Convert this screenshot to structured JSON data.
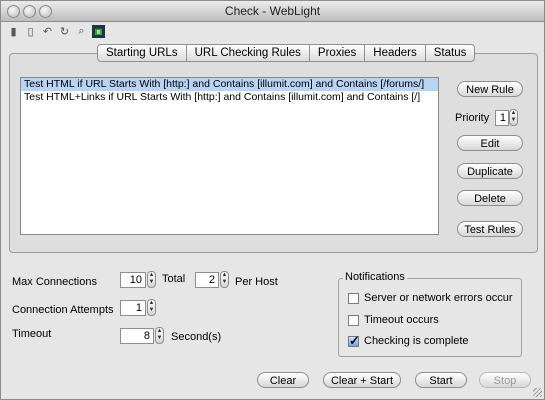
{
  "window": {
    "title": "Check - WebLight"
  },
  "toolbar": {
    "icons": [
      "page-icon",
      "document-icon",
      "back-icon",
      "refresh-icon",
      "inspect-icon",
      "terminal-icon"
    ]
  },
  "tabs": [
    "Starting URLs",
    "URL Checking Rules",
    "Proxies",
    "Headers",
    "Status"
  ],
  "rules": [
    {
      "text": "Test HTML if URL Starts With [http:] and Contains [illumit.com] and Contains [/forums/]",
      "selected": true
    },
    {
      "text": "Test HTML+Links if URL Starts With [http:] and Contains [illumit.com] and Contains [/]",
      "selected": false
    }
  ],
  "side": {
    "new_rule": "New Rule",
    "priority_label": "Priority",
    "priority_value": "1",
    "edit": "Edit",
    "duplicate": "Duplicate",
    "delete": "Delete",
    "test_rules": "Test Rules"
  },
  "settings": {
    "max_connections_label": "Max Connections",
    "max_connections_value": "10",
    "total_label": "Total",
    "per_host_value": "2",
    "per_host_label": "Per Host",
    "connection_attempts_label": "Connection Attempts",
    "connection_attempts_value": "1",
    "timeout_label": "Timeout",
    "timeout_value": "8",
    "seconds_label": "Second(s)"
  },
  "notifications": {
    "title": "Notifications",
    "items": [
      {
        "label": "Server or network errors occur",
        "checked": false
      },
      {
        "label": "Timeout occurs",
        "checked": false
      },
      {
        "label": "Checking is complete",
        "checked": true
      }
    ]
  },
  "actions": {
    "clear": "Clear",
    "clear_start": "Clear + Start",
    "start": "Start",
    "stop": "Stop"
  }
}
